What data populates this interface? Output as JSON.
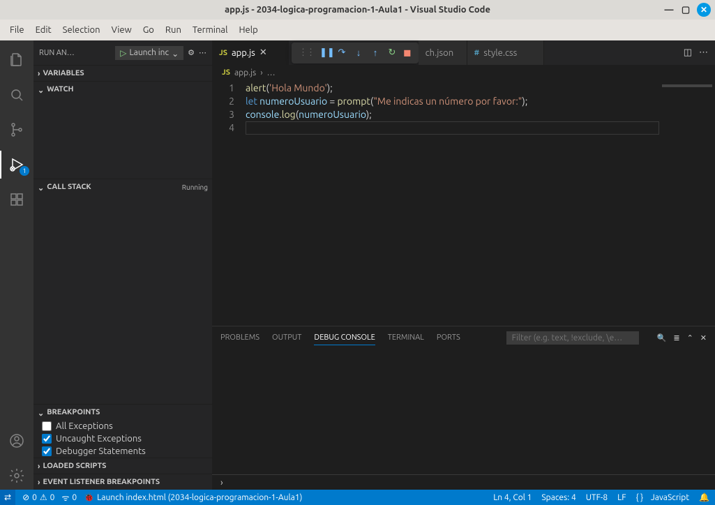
{
  "window": {
    "title": "app.js - 2034-logica-programacion-1-Aula1 - Visual Studio Code"
  },
  "menubar": [
    "File",
    "Edit",
    "Selection",
    "View",
    "Go",
    "Run",
    "Terminal",
    "Help"
  ],
  "activitybar": {
    "debug_badge": "1"
  },
  "sidebar": {
    "title": "RUN AN…",
    "launch_config": "Launch inc",
    "variables": "VARIABLES",
    "watch": "WATCH",
    "callstack": "CALL STACK",
    "callstack_status": "Running",
    "breakpoints": {
      "title": "BREAKPOINTS",
      "items": [
        {
          "label": "All Exceptions",
          "checked": false
        },
        {
          "label": "Uncaught Exceptions",
          "checked": true
        },
        {
          "label": "Debugger Statements",
          "checked": true
        }
      ]
    },
    "loaded_scripts": "LOADED SCRIPTS",
    "event_listener_breakpoints": "EVENT LISTENER BREAKPOINTS"
  },
  "tabs": {
    "active": {
      "name": "app.js",
      "icon": "JS"
    },
    "others": [
      {
        "name": "ch.json",
        "icon": ""
      },
      {
        "name": "style.css",
        "icon": "#"
      }
    ]
  },
  "breadcrumbs": {
    "icon": "JS",
    "file": "app.js",
    "sep": "›",
    "ellipsis": "…"
  },
  "code": {
    "lines": [
      [
        {
          "t": "fn",
          "v": "alert"
        },
        {
          "t": "plain",
          "v": "("
        },
        {
          "t": "str",
          "v": "'Hola Mundo'"
        },
        {
          "t": "plain",
          "v": ");"
        }
      ],
      [
        {
          "t": "kw",
          "v": "let"
        },
        {
          "t": "plain",
          "v": " "
        },
        {
          "t": "var",
          "v": "numeroUsuario"
        },
        {
          "t": "plain",
          "v": " = "
        },
        {
          "t": "fn",
          "v": "prompt"
        },
        {
          "t": "plain",
          "v": "("
        },
        {
          "t": "str",
          "v": "\"Me indicas un número por favor:\""
        },
        {
          "t": "plain",
          "v": ");"
        }
      ],
      [
        {
          "t": "var",
          "v": "console"
        },
        {
          "t": "plain",
          "v": "."
        },
        {
          "t": "fn",
          "v": "log"
        },
        {
          "t": "plain",
          "v": "("
        },
        {
          "t": "var",
          "v": "numeroUsuario"
        },
        {
          "t": "plain",
          "v": ");"
        }
      ],
      [
        {
          "t": "plain",
          "v": ""
        }
      ]
    ],
    "line_numbers": [
      "1",
      "2",
      "3",
      "4"
    ]
  },
  "panel": {
    "tabs": [
      "PROBLEMS",
      "OUTPUT",
      "DEBUG CONSOLE",
      "TERMINAL",
      "PORTS"
    ],
    "active_tab": "DEBUG CONSOLE",
    "filter_placeholder": "Filter (e.g. text, !exclude, \\e…"
  },
  "statusbar": {
    "errors": "0",
    "warnings": "0",
    "ports": "0",
    "launch": "Launch index.html (2034-logica-programacion-1-Aula1)",
    "ln_col": "Ln 4, Col 1",
    "spaces": "Spaces: 4",
    "encoding": "UTF-8",
    "eol": "LF",
    "lang_brackets": "{ }",
    "language": "JavaScript"
  }
}
